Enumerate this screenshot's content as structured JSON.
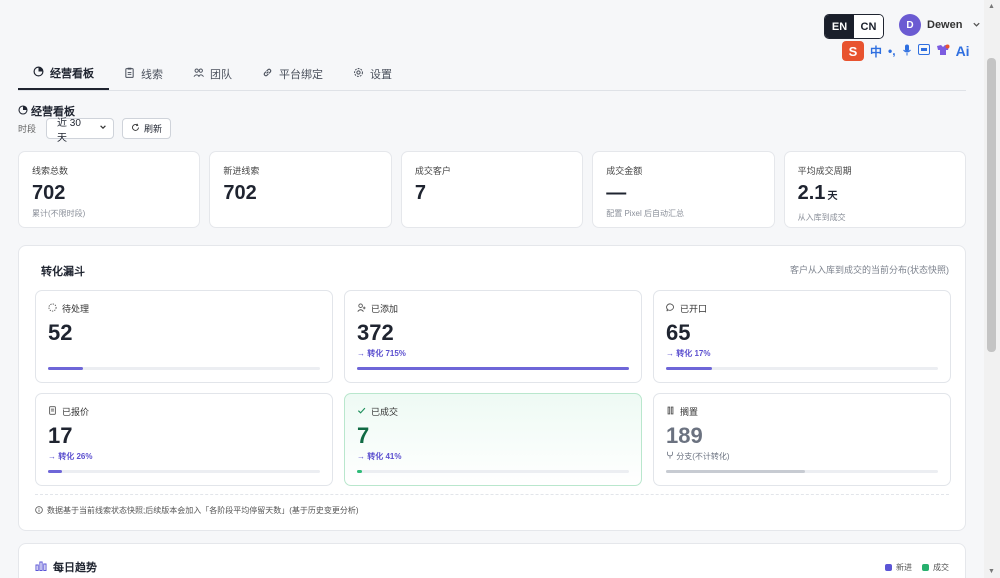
{
  "header": {
    "lang_options": [
      "EN",
      "CN"
    ],
    "active_lang": "EN",
    "user": {
      "initial": "D",
      "name": "Dewen"
    },
    "ime": {
      "logo": "S",
      "mode": "中",
      "punct": "•,",
      "ai": "Ai"
    }
  },
  "tabs": [
    {
      "label": "经营看板",
      "icon": "pie-chart-icon",
      "active": true
    },
    {
      "label": "线索",
      "icon": "clipboard-icon",
      "active": false
    },
    {
      "label": "团队",
      "icon": "team-icon",
      "active": false
    },
    {
      "label": "平台绑定",
      "icon": "link-icon",
      "active": false
    },
    {
      "label": "设置",
      "icon": "gear-icon",
      "active": false
    }
  ],
  "dashboard": {
    "title": "经营看板",
    "period_label": "时段",
    "period_value": "近 30 天",
    "refresh_label": "刷新"
  },
  "kpis": [
    {
      "label": "线索总数",
      "value": "702",
      "unit": "",
      "sub": "累计(不限时段)"
    },
    {
      "label": "新进线索",
      "value": "702",
      "unit": "",
      "sub": ""
    },
    {
      "label": "成交客户",
      "value": "7",
      "unit": "",
      "sub": ""
    },
    {
      "label": "成交金额",
      "value": "—",
      "unit": "",
      "sub": "配置 Pixel 后自动汇总"
    },
    {
      "label": "平均成交周期",
      "value": "2.1",
      "unit": "天",
      "sub": "从入库到成交"
    }
  ],
  "funnel": {
    "title": "转化漏斗",
    "note": "客户从入库到成交的当前分布(状态快照)",
    "stages": [
      {
        "label": "待处理",
        "value": "52",
        "conversion": "",
        "fill": 0.13,
        "variant": "normal",
        "icon": "pending-icon"
      },
      {
        "label": "已添加",
        "value": "372",
        "conversion": "→ 转化 715%",
        "fill": 1.0,
        "variant": "normal",
        "icon": "user-add-icon"
      },
      {
        "label": "已开口",
        "value": "65",
        "conversion": "→ 转化 17%",
        "fill": 0.17,
        "variant": "normal",
        "icon": "chat-icon"
      },
      {
        "label": "已报价",
        "value": "17",
        "conversion": "→ 转化 26%",
        "fill": 0.05,
        "variant": "normal",
        "icon": "document-icon"
      },
      {
        "label": "已成交",
        "value": "7",
        "conversion": "→ 转化 41%",
        "fill": 0.02,
        "variant": "won",
        "icon": "check-icon"
      },
      {
        "label": "搁置",
        "value": "189",
        "conversion": "分支(不计转化)",
        "fill": 0.51,
        "variant": "muted",
        "icon": "pause-icon"
      }
    ],
    "footnote": "数据基于当前线索状态快照;后续版本会加入「各阶段平均停留天数」(基于历史变更分析)"
  },
  "trend": {
    "title": "每日趋势",
    "legend": [
      {
        "label": "新进",
        "color": "#5b55d6"
      },
      {
        "label": "成交",
        "color": "#27b06e"
      }
    ]
  }
}
